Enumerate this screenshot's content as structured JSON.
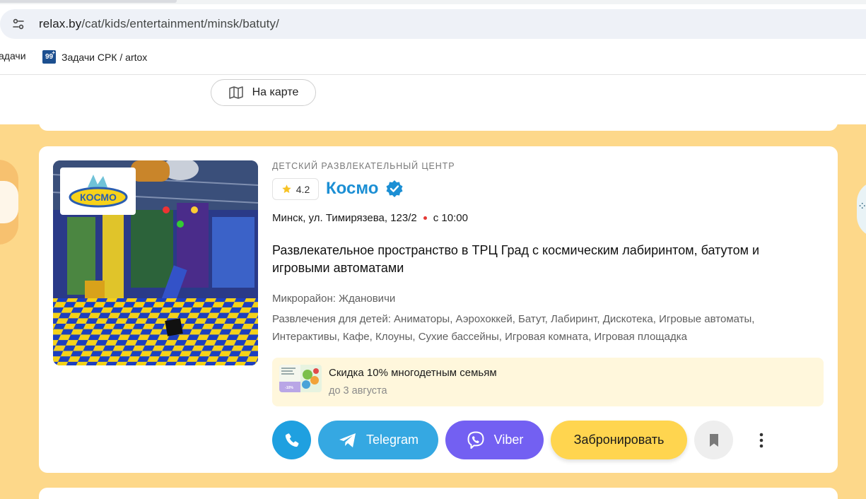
{
  "browser": {
    "url_host": "relax.by",
    "url_path": "/cat/kids/entertainment/minsk/batuty/",
    "bookmarks": [
      {
        "label": "адачи"
      },
      {
        "label": "Задачи СРК / artox",
        "icon_text": "99"
      }
    ]
  },
  "toolbar": {
    "map_button_label": "На карте"
  },
  "listing": {
    "category": "ДЕТСКИЙ РАЗВЛЕКАТЕЛЬНЫЙ ЦЕНТР",
    "rating": "4.2",
    "title": "Космо",
    "verified": true,
    "logo_text": "КОСМО",
    "address": "Минск, ул. Тимирязева, 123/2",
    "hours": "с 10:00",
    "description": "Развлекательное пространство в ТРЦ Град с космическим лабиринтом, батутом и игровыми автоматами",
    "microdistrict": "Микрорайон: Ждановичи",
    "entertainment": "Развлечения для детей: Аниматоры, Аэрохоккей, Батут, Лабиринт, Дискотека, Игровые автоматы, Интерактивы, Кафе, Клоуны, Сухие бассейны, Игровая комната, Игровая площадка",
    "promo": {
      "title": "Скидка 10% многодетным семьям",
      "until": "до 3 августа",
      "thumb_badge": "-10%"
    },
    "actions": {
      "telegram_label": "Telegram",
      "viber_label": "Viber",
      "book_label": "Забронировать"
    }
  },
  "colors": {
    "accent_blue": "#1c8fd4",
    "telegram": "#35a8e2",
    "viber": "#7360f2",
    "book": "#ffd54f",
    "page_bg": "#fdd88a"
  },
  "icons": [
    "site-info-icon",
    "map-icon",
    "star-icon",
    "verified-icon",
    "phone-icon",
    "telegram-icon",
    "viber-icon",
    "bookmark-icon",
    "more-icon"
  ]
}
